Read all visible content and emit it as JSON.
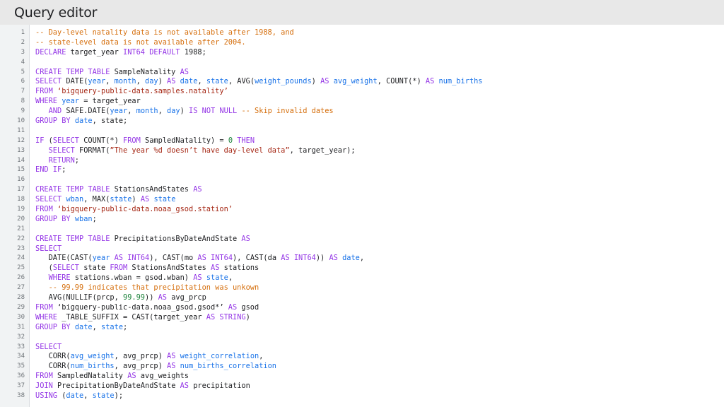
{
  "header": {
    "title": "Query editor"
  },
  "code_lines": [
    [
      [
        "-- Day-level natality data is not available after 1988, and",
        "cm"
      ]
    ],
    [
      [
        "-- state-level data is not available after 2004.",
        "cm"
      ]
    ],
    [
      [
        "DECLARE",
        "kw"
      ],
      [
        " target_year ",
        "plain"
      ],
      [
        "INT64",
        "kw"
      ],
      [
        " ",
        "plain"
      ],
      [
        "DEFAULT",
        "kw"
      ],
      [
        " 1988;",
        "plain"
      ]
    ],
    [],
    [
      [
        "CREATE TEMP TABLE",
        "kw"
      ],
      [
        " SampleNatality ",
        "plain"
      ],
      [
        "AS",
        "kw"
      ]
    ],
    [
      [
        "SELECT",
        "kw"
      ],
      [
        " DATE(",
        "plain"
      ],
      [
        "year",
        "id"
      ],
      [
        ", ",
        "plain"
      ],
      [
        "month",
        "id"
      ],
      [
        ", ",
        "plain"
      ],
      [
        "day",
        "id"
      ],
      [
        ") ",
        "plain"
      ],
      [
        "AS",
        "kw"
      ],
      [
        " ",
        "plain"
      ],
      [
        "date",
        "id"
      ],
      [
        ", ",
        "plain"
      ],
      [
        "state",
        "id"
      ],
      [
        ", AVG(",
        "plain"
      ],
      [
        "weight_pounds",
        "id"
      ],
      [
        ") ",
        "plain"
      ],
      [
        "AS",
        "kw"
      ],
      [
        " ",
        "plain"
      ],
      [
        "avg_weight",
        "id"
      ],
      [
        ", COUNT(*) ",
        "plain"
      ],
      [
        "AS",
        "kw"
      ],
      [
        " ",
        "plain"
      ],
      [
        "num_births",
        "id"
      ]
    ],
    [
      [
        "FROM",
        "kw"
      ],
      [
        " ‘bigquery-public-data.samples.natality’",
        "str"
      ]
    ],
    [
      [
        "WHERE",
        "kw"
      ],
      [
        " ",
        "plain"
      ],
      [
        "year",
        "id"
      ],
      [
        " = target_year",
        "plain"
      ]
    ],
    [
      [
        "   AND",
        "kw"
      ],
      [
        " SAFE.DATE(",
        "plain"
      ],
      [
        "year",
        "id"
      ],
      [
        ", ",
        "plain"
      ],
      [
        "month",
        "id"
      ],
      [
        ", ",
        "plain"
      ],
      [
        "day",
        "id"
      ],
      [
        ") ",
        "plain"
      ],
      [
        "IS NOT NULL",
        "kw"
      ],
      [
        " -- Skip invalid dates",
        "cm"
      ]
    ],
    [
      [
        "GROUP BY",
        "kw"
      ],
      [
        " ",
        "plain"
      ],
      [
        "date",
        "id"
      ],
      [
        ", state;",
        "plain"
      ]
    ],
    [],
    [
      [
        "IF",
        "kw"
      ],
      [
        " (",
        "plain"
      ],
      [
        "SELECT",
        "kw"
      ],
      [
        " COUNT(*) ",
        "plain"
      ],
      [
        "FROM",
        "kw"
      ],
      [
        " SampledNatality) = ",
        "plain"
      ],
      [
        "0",
        "num"
      ],
      [
        " ",
        "plain"
      ],
      [
        "THEN",
        "kw"
      ]
    ],
    [
      [
        "   SELECT",
        "kw"
      ],
      [
        " FORMAT(",
        "plain"
      ],
      [
        "”The year %d doesn’t have day-level data”",
        "str"
      ],
      [
        ", target_year);",
        "plain"
      ]
    ],
    [
      [
        "   RETURN",
        "kw"
      ],
      [
        ";",
        "plain"
      ]
    ],
    [
      [
        "END IF",
        "kw"
      ],
      [
        ";",
        "plain"
      ]
    ],
    [],
    [
      [
        "CREATE TEMP TABLE",
        "kw"
      ],
      [
        " StationsAndStates ",
        "plain"
      ],
      [
        "AS",
        "kw"
      ]
    ],
    [
      [
        "SELECT",
        "kw"
      ],
      [
        " ",
        "plain"
      ],
      [
        "wban",
        "id"
      ],
      [
        ", MAX(",
        "plain"
      ],
      [
        "state",
        "id"
      ],
      [
        ") ",
        "plain"
      ],
      [
        "AS",
        "kw"
      ],
      [
        " ",
        "plain"
      ],
      [
        "state",
        "id"
      ]
    ],
    [
      [
        "FROM",
        "kw"
      ],
      [
        " ‘bigquery-public-data.noaa_gsod.station’",
        "str"
      ]
    ],
    [
      [
        "GROUP BY",
        "kw"
      ],
      [
        " ",
        "plain"
      ],
      [
        "wban",
        "id"
      ],
      [
        ";",
        "plain"
      ]
    ],
    [],
    [
      [
        "CREATE TEMP TABLE",
        "kw"
      ],
      [
        " PrecipitationsByDateAndState ",
        "plain"
      ],
      [
        "AS",
        "kw"
      ]
    ],
    [
      [
        "SELECT",
        "kw"
      ]
    ],
    [
      [
        "   DATE(CAST(",
        "plain"
      ],
      [
        "year",
        "id"
      ],
      [
        " ",
        "plain"
      ],
      [
        "AS",
        "kw"
      ],
      [
        " ",
        "plain"
      ],
      [
        "INT64",
        "kw"
      ],
      [
        "), CAST(mo ",
        "plain"
      ],
      [
        "AS",
        "kw"
      ],
      [
        " ",
        "plain"
      ],
      [
        "INT64",
        "kw"
      ],
      [
        "), CAST(da ",
        "plain"
      ],
      [
        "AS",
        "kw"
      ],
      [
        " ",
        "plain"
      ],
      [
        "INT64",
        "kw"
      ],
      [
        ")) ",
        "plain"
      ],
      [
        "AS",
        "kw"
      ],
      [
        " ",
        "plain"
      ],
      [
        "date",
        "id"
      ],
      [
        ",",
        "plain"
      ]
    ],
    [
      [
        "   (",
        "plain"
      ],
      [
        "SELECT",
        "kw"
      ],
      [
        " state ",
        "plain"
      ],
      [
        "FROM",
        "kw"
      ],
      [
        " StationsAndStates ",
        "plain"
      ],
      [
        "AS",
        "kw"
      ],
      [
        " stations",
        "plain"
      ]
    ],
    [
      [
        "   WHERE",
        "kw"
      ],
      [
        " stations.wban = gsod.wban) ",
        "plain"
      ],
      [
        "AS",
        "kw"
      ],
      [
        " ",
        "plain"
      ],
      [
        "state",
        "id"
      ],
      [
        ",",
        "plain"
      ]
    ],
    [
      [
        "   -- 99.99 indicates that precipitation was unkown",
        "cm"
      ]
    ],
    [
      [
        "   AVG(NULLIF(prcp, ",
        "plain"
      ],
      [
        "99.99",
        "num"
      ],
      [
        ")) ",
        "plain"
      ],
      [
        "AS",
        "kw"
      ],
      [
        " avg_prcp",
        "plain"
      ]
    ],
    [
      [
        "FROM",
        "kw"
      ],
      [
        " ‘bigquery-public-data.noaa_gsod.gsod*’ ",
        "plain"
      ],
      [
        "AS",
        "kw"
      ],
      [
        " gsod",
        "plain"
      ]
    ],
    [
      [
        "WHERE",
        "kw"
      ],
      [
        " _TABLE_SUFFIX = CAST(target_year ",
        "plain"
      ],
      [
        "AS",
        "kw"
      ],
      [
        " ",
        "plain"
      ],
      [
        "STRING",
        "kw"
      ],
      [
        ")",
        "plain"
      ]
    ],
    [
      [
        "GROUP BY",
        "kw"
      ],
      [
        " ",
        "plain"
      ],
      [
        "date",
        "id"
      ],
      [
        ", ",
        "plain"
      ],
      [
        "state",
        "id"
      ],
      [
        ";",
        "plain"
      ]
    ],
    [],
    [
      [
        "SELECT",
        "kw"
      ]
    ],
    [
      [
        "   CORR(",
        "plain"
      ],
      [
        "avg_weight",
        "id"
      ],
      [
        ", avg_prcp) ",
        "plain"
      ],
      [
        "AS",
        "kw"
      ],
      [
        " ",
        "plain"
      ],
      [
        "weight_correlation",
        "id"
      ],
      [
        ",",
        "plain"
      ]
    ],
    [
      [
        "   CORR(",
        "plain"
      ],
      [
        "num_births",
        "id"
      ],
      [
        ", avg_prcp) ",
        "plain"
      ],
      [
        "AS",
        "kw"
      ],
      [
        " ",
        "plain"
      ],
      [
        "num_births_correlation",
        "id"
      ]
    ],
    [
      [
        "FROM",
        "kw"
      ],
      [
        " SampledNatality ",
        "plain"
      ],
      [
        "AS",
        "kw"
      ],
      [
        " avg_weights",
        "plain"
      ]
    ],
    [
      [
        "JOIN",
        "kw"
      ],
      [
        " PrecipitationByDateAndState ",
        "plain"
      ],
      [
        "AS",
        "kw"
      ],
      [
        " precipitation",
        "plain"
      ]
    ],
    [
      [
        "USING",
        "kw"
      ],
      [
        " (",
        "plain"
      ],
      [
        "date",
        "id"
      ],
      [
        ", ",
        "plain"
      ],
      [
        "state",
        "id"
      ],
      [
        ");",
        "plain"
      ]
    ]
  ],
  "colors": {
    "keyword": "#9334e6",
    "identifier": "#1a73e8",
    "string": "#a52714",
    "comment": "#d56e0c",
    "number": "#188038"
  }
}
